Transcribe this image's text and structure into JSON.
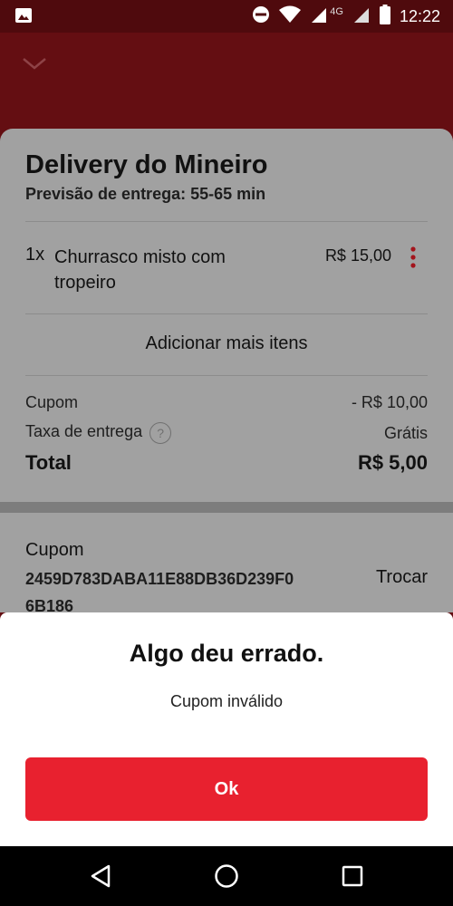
{
  "status_bar": {
    "time": "12:22",
    "network": "4G",
    "icons": [
      "image-icon",
      "do-not-disturb-icon",
      "wifi-icon",
      "signal-icon",
      "battery-icon"
    ]
  },
  "header": {
    "collapse_icon": "chevron-down-icon"
  },
  "order": {
    "store_name": "Delivery do Mineiro",
    "eta": "Previsão de entrega: 55-65 min",
    "items": [
      {
        "qty": "1x",
        "name": "Churrasco misto com tropeiro",
        "price": "R$ 15,00"
      }
    ],
    "add_more": "Adicionar mais itens",
    "summary": {
      "coupon_label": "Cupom",
      "coupon_value": "- R$ 10,00",
      "delivery_label": "Taxa de entrega",
      "delivery_help": "?",
      "delivery_value": "Grátis",
      "total_label": "Total",
      "total_value": "R$ 5,00"
    }
  },
  "coupon": {
    "title": "Cupom",
    "code": "2459D783DABA11E88DB36D239F06B186",
    "change": "Trocar"
  },
  "dialog": {
    "title": "Algo deu errado.",
    "message": "Cupom inválido",
    "ok": "Ok"
  },
  "colors": {
    "brand_dark": "#640e12",
    "accent": "#e8212f",
    "overlay_sheet": "#a1a1a1"
  }
}
